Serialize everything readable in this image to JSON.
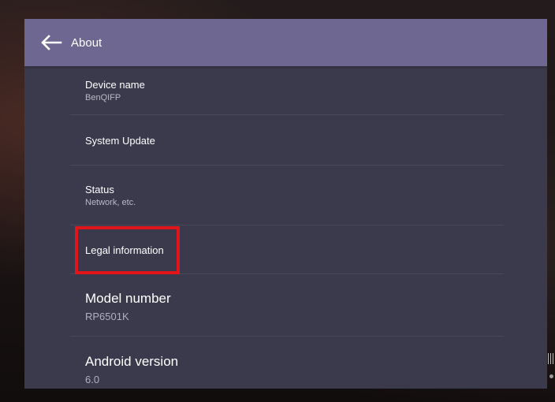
{
  "app_bar": {
    "title": "About",
    "back_icon": "arrow-left-icon",
    "color": "#6e6791"
  },
  "items": [
    {
      "title": "Device name",
      "subtitle": "BenQIFP"
    },
    {
      "title": "System Update",
      "subtitle": ""
    },
    {
      "title": "Status",
      "subtitle": "Network, etc."
    },
    {
      "title": "Legal information",
      "subtitle": ""
    },
    {
      "title": "Model number",
      "subtitle": "RP6501K"
    },
    {
      "title": "Android version",
      "subtitle": "6.0"
    }
  ],
  "highlight": {
    "target": "Legal information",
    "color": "#e2151b"
  },
  "colors": {
    "panel_background": "#3b3a4c",
    "divider": "#4a495c"
  }
}
